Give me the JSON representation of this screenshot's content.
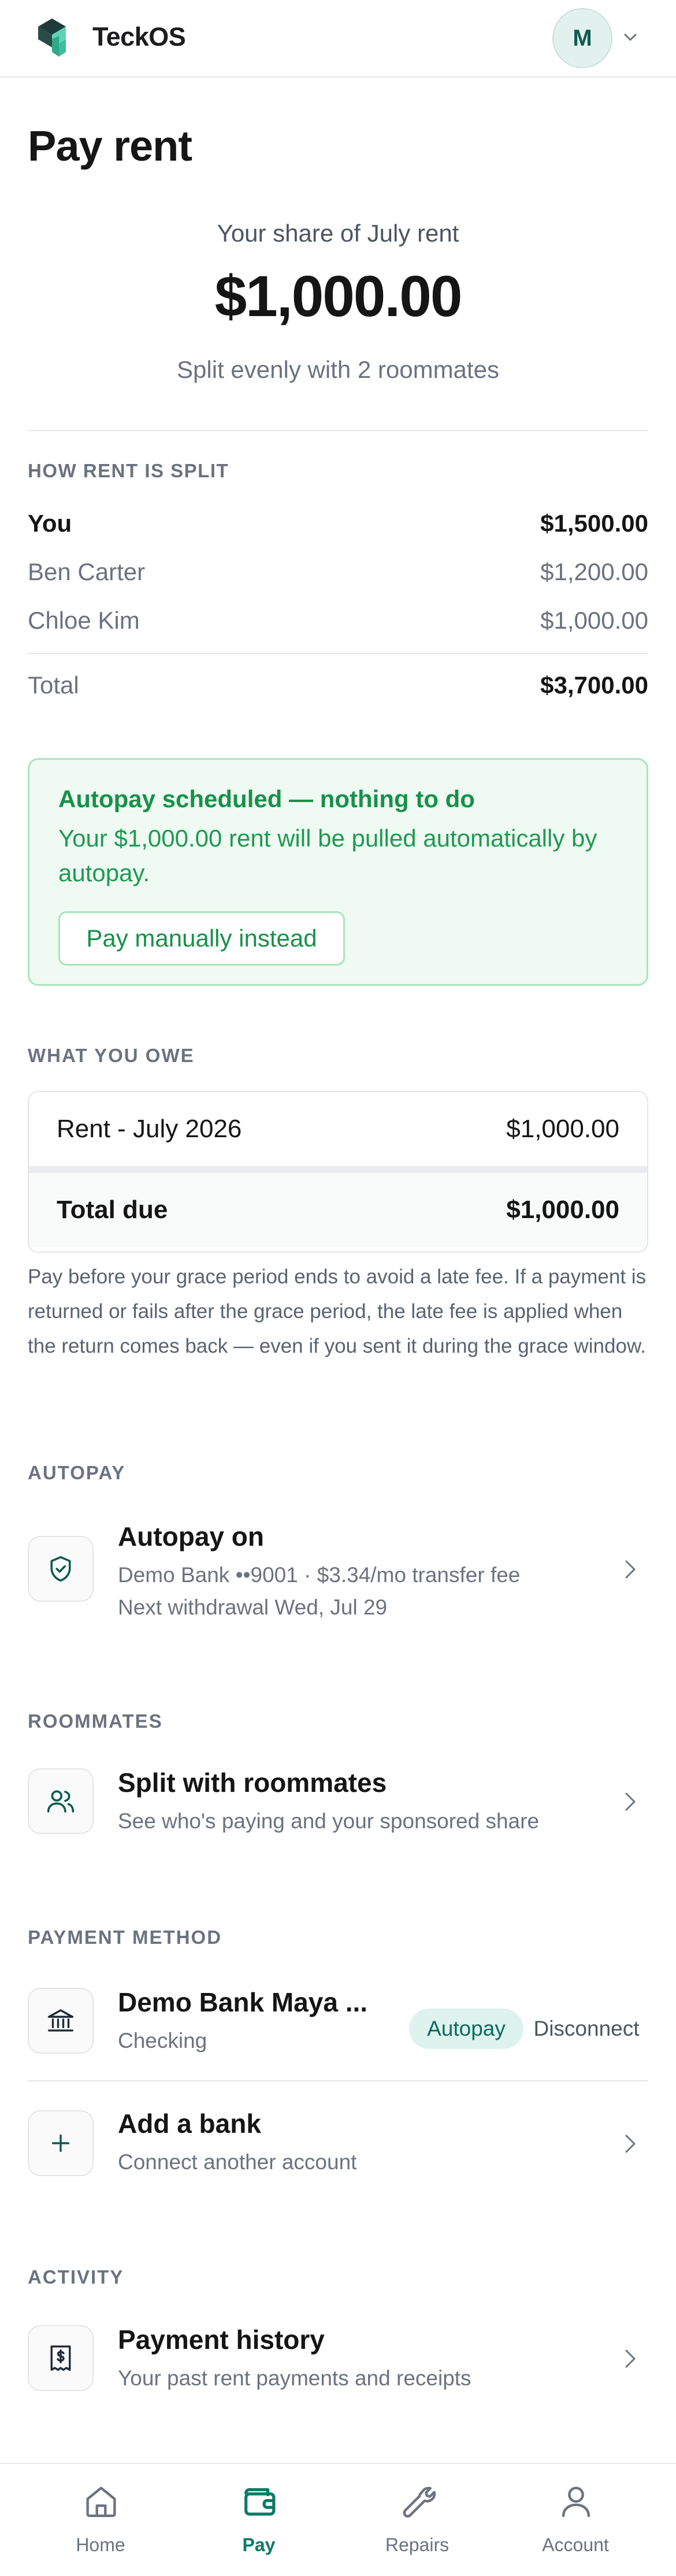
{
  "app": {
    "brand": "TeckOS",
    "avatar_initial": "M"
  },
  "page": {
    "title": "Pay rent"
  },
  "summary": {
    "share_label": "Your share of July rent",
    "share_amount": "$1,000.00",
    "split_note": "Split evenly with 2 roommates"
  },
  "split": {
    "heading": "HOW RENT IS SPLIT",
    "rows": [
      {
        "name": "You",
        "amount": "$1,500.00"
      },
      {
        "name": "Ben Carter",
        "amount": "$1,200.00"
      },
      {
        "name": "Chloe Kim",
        "amount": "$1,000.00"
      }
    ],
    "total_label": "Total",
    "total_amount": "$3,700.00"
  },
  "autopay_notice": {
    "title": "Autopay scheduled — nothing to do",
    "body": "Your $1,000.00 rent will be pulled automatically by autopay.",
    "button": "Pay manually instead"
  },
  "owe": {
    "heading": "WHAT YOU OWE",
    "line_label": "Rent - July 2026",
    "line_amount": "$1,000.00",
    "total_label": "Total due",
    "total_amount": "$1,000.00",
    "note": "Pay before your grace period ends to avoid a late fee. If a payment is returned or fails after the grace period, the late fee is applied when the return comes back — even if you sent it during the grace window."
  },
  "autopay": {
    "heading": "AUTOPAY",
    "title": "Autopay on",
    "line1": "Demo Bank ••9001 · $3.34/mo transfer fee",
    "line2": "Next withdrawal Wed, Jul 29"
  },
  "roommates": {
    "heading": "ROOMMATES",
    "title": "Split with roommates",
    "subtitle": "See who's paying and your sponsored share"
  },
  "payment_method": {
    "heading": "PAYMENT METHOD",
    "bank_title": "Demo Bank Maya ...",
    "bank_sub": "Checking",
    "badge": "Autopay",
    "disconnect": "Disconnect",
    "add_title": "Add a bank",
    "add_sub": "Connect another account"
  },
  "activity": {
    "heading": "ACTIVITY",
    "title": "Payment history",
    "subtitle": "Your past rent payments and receipts"
  },
  "tabs": [
    {
      "label": "Home"
    },
    {
      "label": "Pay"
    },
    {
      "label": "Repairs"
    },
    {
      "label": "Account"
    }
  ],
  "colors": {
    "accent": "#0c7a66",
    "success": "#17914a",
    "success_bg": "#eefaf2"
  }
}
